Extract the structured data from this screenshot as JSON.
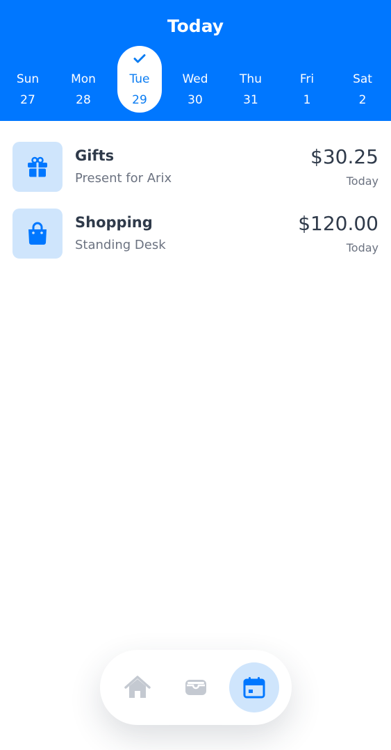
{
  "header": {
    "title": "Today"
  },
  "days": [
    {
      "name": "Sun",
      "num": "27"
    },
    {
      "name": "Mon",
      "num": "28"
    },
    {
      "name": "Tue",
      "num": "29",
      "selected": true
    },
    {
      "name": "Wed",
      "num": "30"
    },
    {
      "name": "Thu",
      "num": "31"
    },
    {
      "name": "Fri",
      "num": "1"
    },
    {
      "name": "Sat",
      "num": "2"
    }
  ],
  "transactions": [
    {
      "icon": "gift-icon",
      "title": "Gifts",
      "subtitle": "Present for Arix",
      "amount": "$30.25",
      "date": "Today"
    },
    {
      "icon": "shopping-bag-icon",
      "title": "Shopping",
      "subtitle": "Standing Desk",
      "amount": "$120.00",
      "date": "Today"
    }
  ],
  "bottom_nav": {
    "items": [
      {
        "icon": "home-icon",
        "active": false
      },
      {
        "icon": "wallet-icon",
        "active": false
      },
      {
        "icon": "calendar-icon",
        "active": true
      }
    ]
  },
  "colors": {
    "accent": "#0077ff",
    "icon_bg": "#cfe5fc",
    "inactive_icon": "#c4c9d1"
  }
}
